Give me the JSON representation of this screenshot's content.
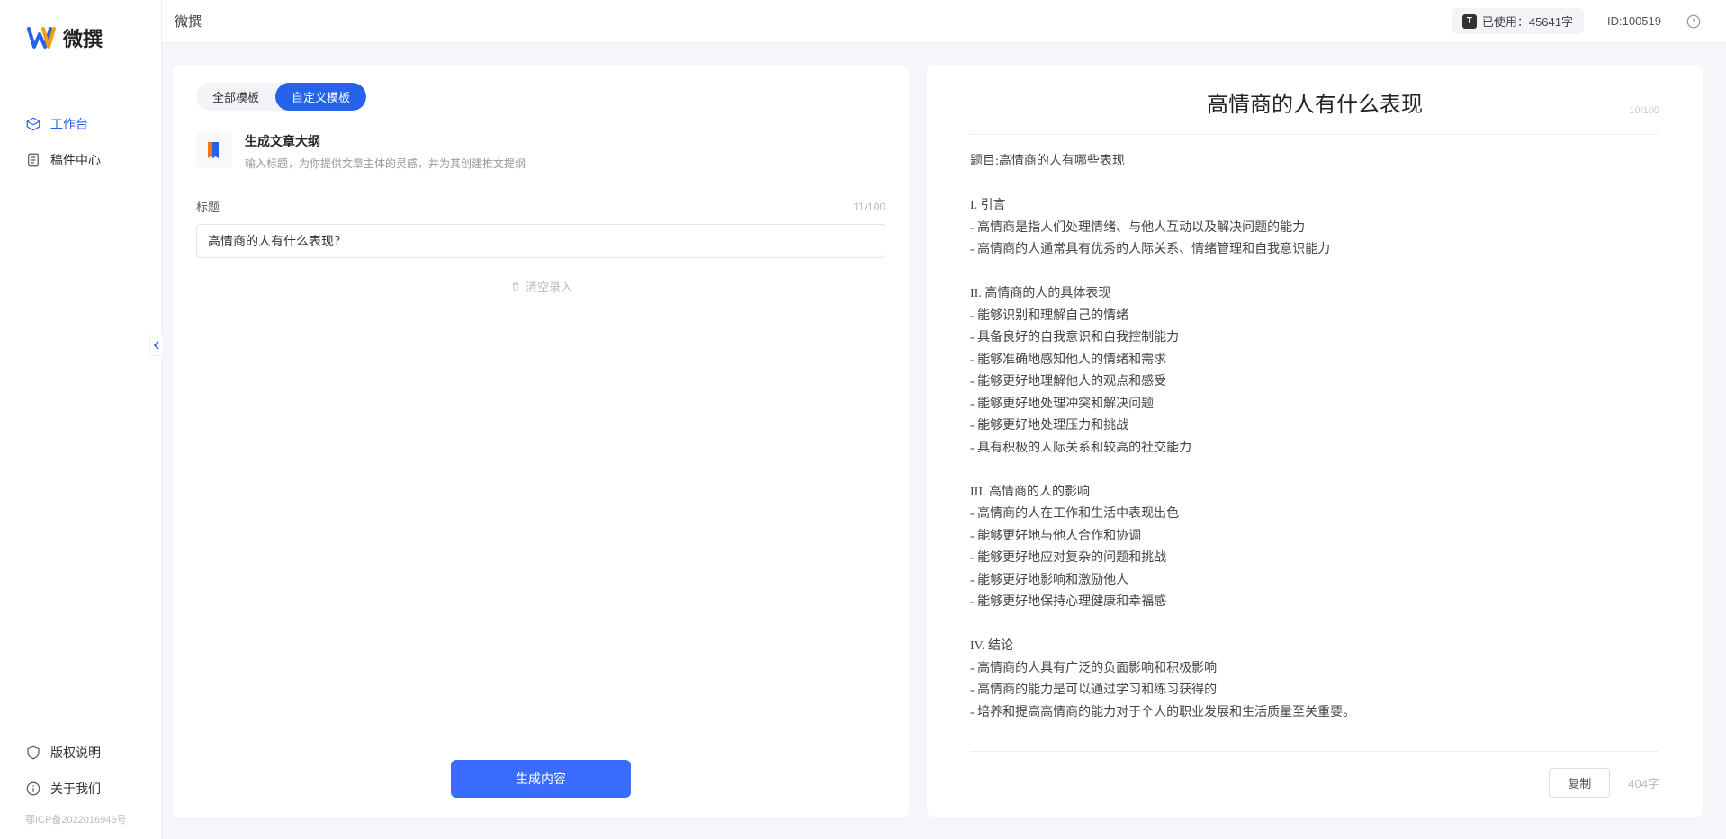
{
  "app": {
    "name": "微撰",
    "logo_text": "微撰"
  },
  "sidebar": {
    "nav": [
      {
        "label": "工作台",
        "icon": "cube",
        "active": true
      },
      {
        "label": "稿件中心",
        "icon": "doc",
        "active": false
      }
    ],
    "bottom": [
      {
        "label": "版权说明",
        "icon": "shield"
      },
      {
        "label": "关于我们",
        "icon": "info"
      }
    ],
    "icp": "鄂ICP备2022016946号"
  },
  "topbar": {
    "title": "微撰",
    "usage_label": "已使用：45641字",
    "id_label": "ID:100519"
  },
  "left_panel": {
    "tabs": [
      {
        "label": "全部模板",
        "active": false
      },
      {
        "label": "自定义模板",
        "active": true
      }
    ],
    "template": {
      "icon_emoji": "📄",
      "title": "生成文章大纲",
      "desc": "输入标题，为你提供文章主体的灵感，并为其创建推文提纲"
    },
    "title_field": {
      "label": "标题",
      "counter": "11/100",
      "value": "高情商的人有什么表现？"
    },
    "clear_label": "清空录入",
    "generate_label": "生成内容"
  },
  "right_panel": {
    "title": "高情商的人有什么表现",
    "title_counter": "10/100",
    "body": "题目:高情商的人有哪些表现\n\nI. 引言\n- 高情商是指人们处理情绪、与他人互动以及解决问题的能力\n- 高情商的人通常具有优秀的人际关系、情绪管理和自我意识能力\n\nII. 高情商的人的具体表现\n- 能够识别和理解自己的情绪\n- 具备良好的自我意识和自我控制能力\n- 能够准确地感知他人的情绪和需求\n- 能够更好地理解他人的观点和感受\n- 能够更好地处理冲突和解决问题\n- 能够更好地处理压力和挑战\n- 具有积极的人际关系和较高的社交能力\n\nIII. 高情商的人的影响\n- 高情商的人在工作和生活中表现出色\n- 能够更好地与他人合作和协调\n- 能够更好地应对复杂的问题和挑战\n- 能够更好地影响和激励他人\n- 能够更好地保持心理健康和幸福感\n\nIV. 结论\n- 高情商的人具有广泛的负面影响和积极影响\n- 高情商的能力是可以通过学习和练习获得的\n- 培养和提高高情商的能力对于个人的职业发展和生活质量至关重要。",
    "copy_label": "复制",
    "char_count": "404字"
  }
}
